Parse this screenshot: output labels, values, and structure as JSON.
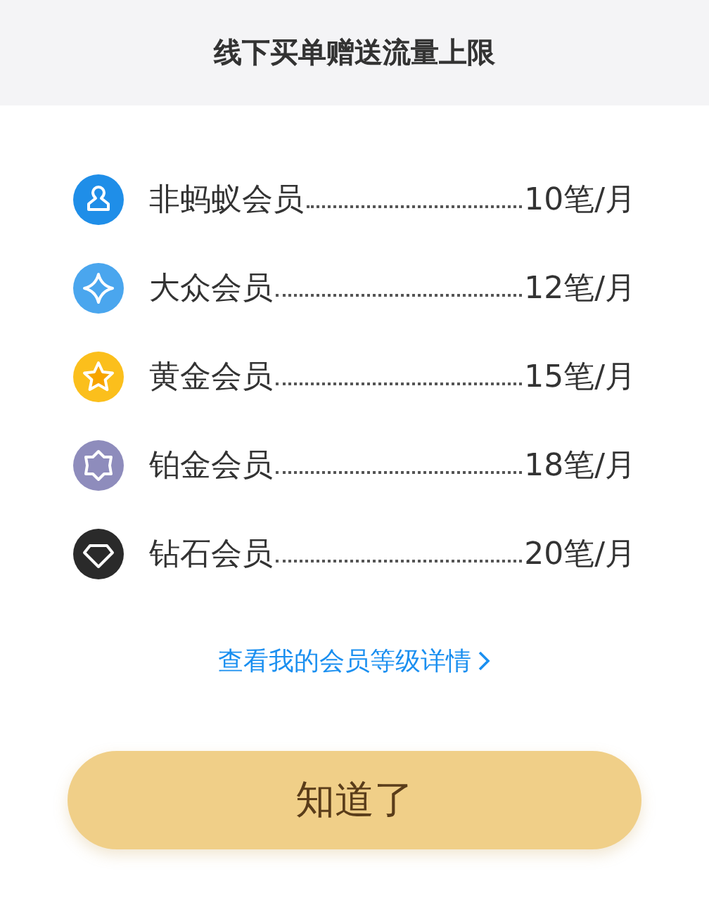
{
  "header": {
    "title": "线下买单赠送流量上限"
  },
  "tiers": [
    {
      "kind": "person",
      "color": "#1f8ee8",
      "name": "非蚂蚁会员",
      "limit": "10笔/月"
    },
    {
      "kind": "sparkle",
      "color": "#4aa6ee",
      "name": "大众会员",
      "limit": "12笔/月"
    },
    {
      "kind": "star",
      "color": "#fbbf1c",
      "name": "黄金会员",
      "limit": "15笔/月"
    },
    {
      "kind": "hexagon",
      "color": "#8e8cbc",
      "name": "铂金会员",
      "limit": "18笔/月"
    },
    {
      "kind": "diamond",
      "color": "#2a2a2a",
      "name": "钻石会员",
      "limit": "20笔/月"
    }
  ],
  "link": {
    "label": "查看我的会员等级详情"
  },
  "button": {
    "label": "知道了"
  }
}
